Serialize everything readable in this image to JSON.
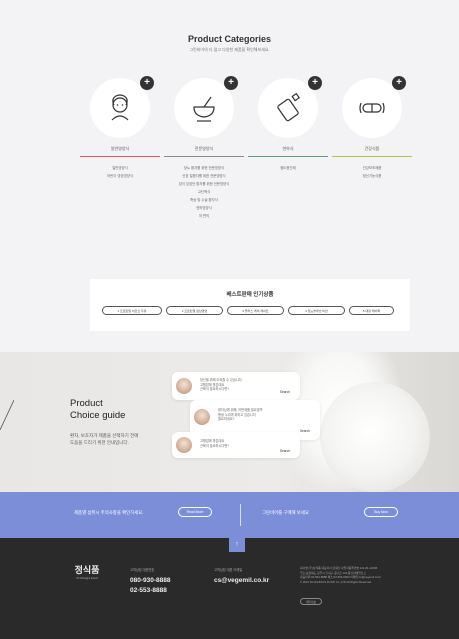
{
  "categories_section": {
    "title": "Product Categories",
    "subtitle": "그린비아의 더 많고 다양한 제품을 확인해보세요.",
    "categories": [
      {
        "name": "일반영양식",
        "bar_color": "#e05b58",
        "icon": "eldercare-icon",
        "items": [
          "일반영양식",
          "어린이 영양영양식"
        ]
      },
      {
        "name": "전문영양식",
        "bar_color": "#8a8a8a",
        "icon": "bowl-icon",
        "items": [
          "당뇨 환자를 위한 전문영양식",
          "신장 질환자를 위한 전문영양식",
          "암이 있었던 환자를 위한 전문영양식",
          "고단백식",
          "죽상 및 수술 환자식",
          "연하영양식",
          "저 편의"
        ]
      },
      {
        "name": "연하식",
        "bar_color": "#5a9d7b",
        "icon": "pouch-icon",
        "items": [
          "점도증진제"
        ]
      },
      {
        "name": "건강식품",
        "bar_color": "#b3c050",
        "icon": "capsule-icon",
        "items": [
          "건강보조제품",
          "정신기능식품"
        ]
      }
    ]
  },
  "best_sellers": {
    "title": "베스트판매 인기상품",
    "tags": [
      "1 프로틴밀 어르신 두유",
      "2 프로틴밀 점심영양",
      "3 플러스 케어 레이트",
      "4 당뇨솔루션 비만",
      "5 대장 케어팩"
    ]
  },
  "choice_guide": {
    "title_line1": "Product",
    "title_line2": "Choice guide",
    "desc_line1": "환자, 보호자가 제품을 선택하기 전에",
    "desc_line2": "도움을 드리기 위한 안내입니다.",
    "cards": [
      {
        "line1": "당신을 위해 도와줄 수 있습니다.",
        "line2": "고혈압에 좋은데요",
        "line3": "근육이 필요하시다면?",
        "search": "Search"
      },
      {
        "line1": "환자님께 위해, 어떤제품 필요할까",
        "line2": "평생 누리며 위하고 있습니다",
        "line3": "필요하세요?",
        "search": "Search"
      },
      {
        "line1": "고혈압에 좋은데요",
        "line2": "근육이 필요하시다면?",
        "line3": "",
        "search": "Search"
      }
    ]
  },
  "notice": {
    "left_text": "제품별 섭취시 주의사항을 확인하세요.",
    "left_btn": "Read More",
    "right_text": "그린비아를 구매해 보세요",
    "right_btn": "Buy Now"
  },
  "footer": {
    "top_btn": "↑",
    "logo_kr": "정식품",
    "logo_en": "Dr.Chung's Food",
    "cs_label": "고객상담 대표번호",
    "phone1": "080-930-8888",
    "phone2": "02-553-8888",
    "email_label": "고객상담 대표 이메일",
    "email": "cs@vegemil.co.kr",
    "info_lines": [
      "회사명:(주)정식품 대표이사:김재진 사업자등록번호:121-81-12345",
      "주소:충청북도 청주시 흥덕구 공단로 134 통신판매업신고",
      "대표전화:02-553-8888 팩스:02-553-0000 이메일:cs@vegemil.co.kr",
      "© 2021 Dr.CHUNG'S FOOD Co.,LTD All Rights Reserved."
    ],
    "policy_btn": "개인정보"
  }
}
